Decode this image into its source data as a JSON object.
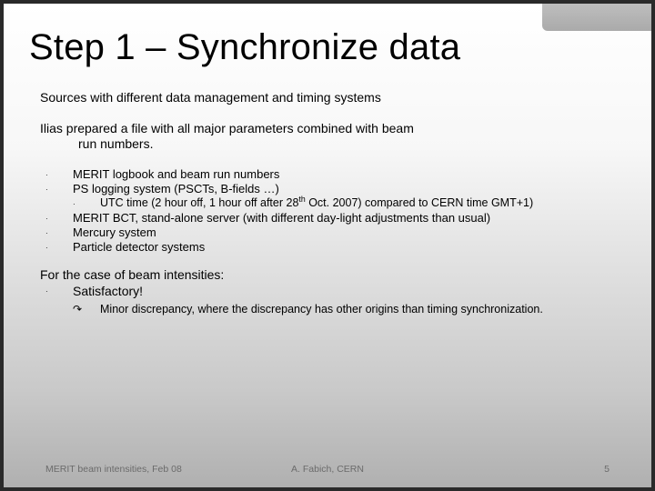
{
  "title": "Step 1 – Synchronize data",
  "para1": "Sources with different data management and timing systems",
  "para2_line1": "Ilias prepared a file with all major parameters combined with beam",
  "para2_line2": "run numbers.",
  "bullets": {
    "b1": "MERIT logbook and beam run numbers",
    "b2": "PS logging system (PSCTs, B-fields …)",
    "b2sub_pre": "UTC time (2 hour off, 1 hour off after 28",
    "b2sub_sup": "th",
    "b2sub_post": " Oct. 2007) compared to CERN time GMT+1)",
    "b3": "MERIT BCT, stand-alone server (with different day-light adjustments than usual)",
    "b4": "Mercury system",
    "b5": "Particle detector systems"
  },
  "case": {
    "line1": "For the case of beam intensities:",
    "line2": "Satisfactory!",
    "sub": "Minor discrepancy, where the discrepancy has other origins than timing synchronization."
  },
  "footer": {
    "left": "MERIT beam intensities, Feb 08",
    "center": "A. Fabich, CERN",
    "right": "5"
  },
  "marks": {
    "dot": "·",
    "arrow": "↷"
  }
}
